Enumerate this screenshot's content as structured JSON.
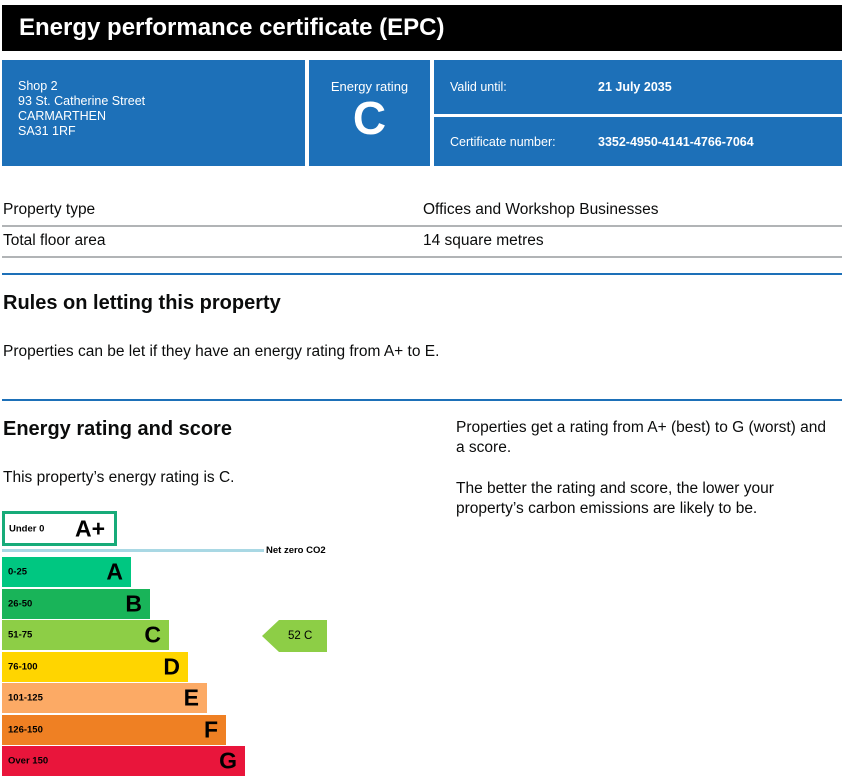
{
  "header": {
    "title": "Energy performance certificate (EPC)"
  },
  "address": {
    "lines": [
      "Shop 2",
      "93 St. Catherine Street",
      "CARMARTHEN",
      "SA31 1RF"
    ]
  },
  "rating_box": {
    "label": "Energy rating",
    "value": "C"
  },
  "validity": {
    "label": "Valid until:",
    "value": "21 July 2035"
  },
  "certificate": {
    "label": "Certificate number:",
    "value": "3352-4950-4141-4766-7064"
  },
  "property": {
    "rows": [
      {
        "label": "Property type",
        "value": "Offices and Workshop Businesses"
      },
      {
        "label": "Total floor area",
        "value": "14 square metres"
      }
    ]
  },
  "letting": {
    "heading": "Rules on letting this property",
    "text": "Properties can be let if they have an energy rating from A+ to E."
  },
  "energy": {
    "heading": "Energy rating and score",
    "current_text": "This property’s energy rating is C.",
    "explain_1": "Properties get a rating from A+ (best) to G (worst) and a score.",
    "explain_2": "The better the rating and score, the lower your property’s carbon emissions are likely to be."
  },
  "scale": {
    "aplus": {
      "range": "Under 0",
      "letter": "A+",
      "color": "#17ab79"
    },
    "net_zero_label": "Net zero CO2",
    "bands": [
      {
        "range": "0-25",
        "letter": "A",
        "color": "#00c781"
      },
      {
        "range": "26-50",
        "letter": "B",
        "color": "#19b459"
      },
      {
        "range": "51-75",
        "letter": "C",
        "color": "#8dce46"
      },
      {
        "range": "76-100",
        "letter": "D",
        "color": "#ffd500"
      },
      {
        "range": "101-125",
        "letter": "E",
        "color": "#fcaa65"
      },
      {
        "range": "126-150",
        "letter": "F",
        "color": "#ef8023"
      },
      {
        "range": "Over 150",
        "letter": "G",
        "color": "#e9153b"
      }
    ],
    "current": {
      "score": "52",
      "letter": "C",
      "color": "#8dce46"
    }
  }
}
